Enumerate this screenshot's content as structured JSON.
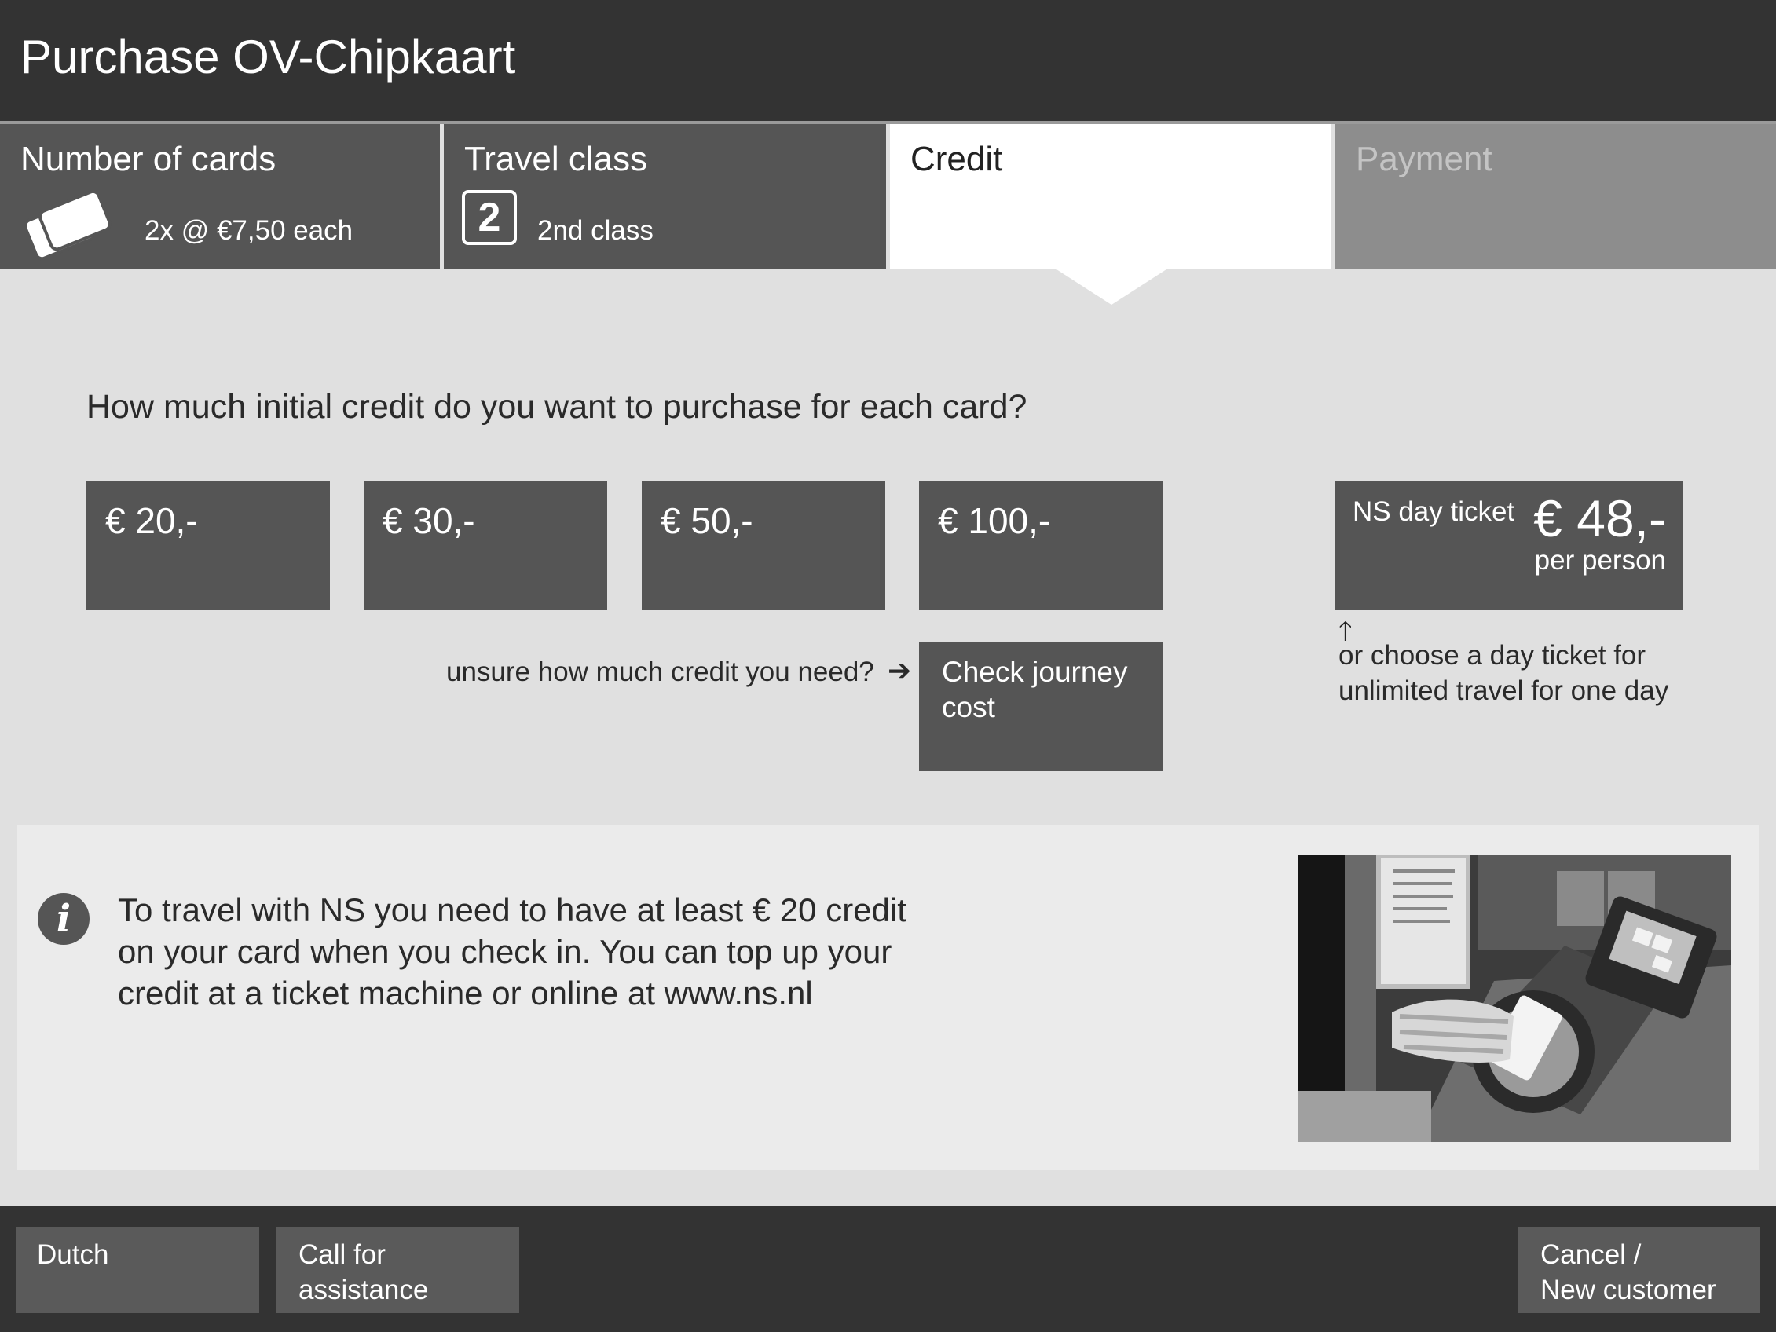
{
  "header": {
    "title": "Purchase OV-Chipkaart"
  },
  "steps": [
    {
      "title": "Number of cards",
      "detail": "2x @ €7,50 each",
      "icon": "cards-icon"
    },
    {
      "title": "Travel class",
      "badge": "2",
      "detail": "2nd class"
    },
    {
      "title": "Credit",
      "state": "active"
    },
    {
      "title": "Payment",
      "state": "disabled"
    }
  ],
  "main": {
    "question": "How much initial credit do you want to purchase for each card?",
    "amounts": [
      "€ 20,-",
      "€ 30,-",
      "€ 50,-",
      "€ 100,-"
    ],
    "unsure_text": "unsure how much credit you need?",
    "unsure_arrow": "➔",
    "check_journey": {
      "line1": "Check journey",
      "line2": "cost"
    },
    "day_ticket": {
      "label": "NS day ticket",
      "price": "€ 48,-",
      "per": "per person",
      "arrow": "🡑",
      "hint_line1": "or choose a day ticket for",
      "hint_line2": "unlimited travel for one day"
    }
  },
  "info": {
    "icon_glyph": "i",
    "lines": [
      "To travel with NS you need to have at least € 20 credit",
      "on your card when you check in. You can top up your",
      "credit at a ticket machine or online at www.ns.nl"
    ]
  },
  "footer": {
    "dutch": "Dutch",
    "assist": {
      "line1": "Call for",
      "line2": "assistance"
    },
    "cancel": {
      "line1": "Cancel /",
      "line2": "New customer"
    }
  },
  "colors": {
    "header_bg": "#333333",
    "tile_bg": "#555555",
    "page_bg": "#e0e0e0",
    "active_step_bg": "#ffffff",
    "disabled_step_bg": "#8d8d8d"
  }
}
